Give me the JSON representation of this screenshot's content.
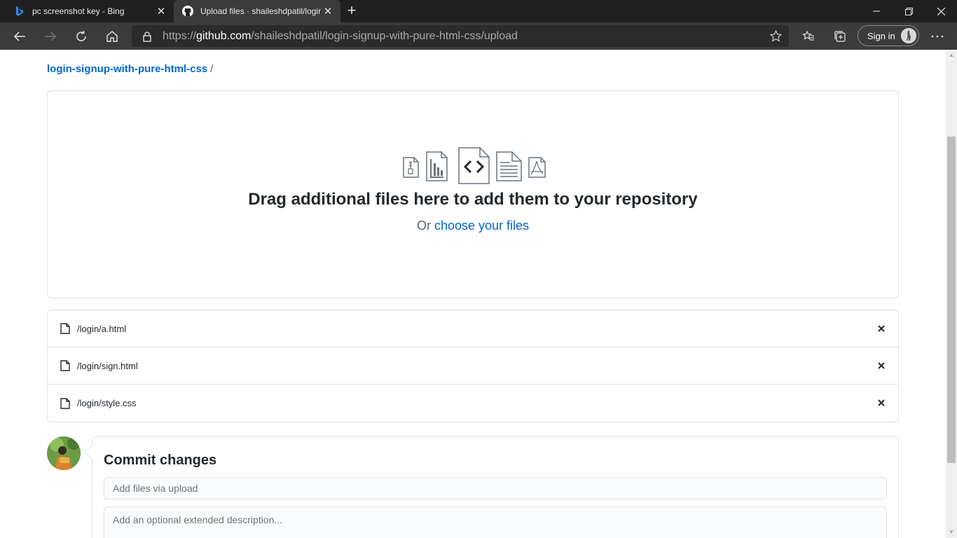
{
  "browser": {
    "tabs": [
      {
        "title": "pc screenshot key - Bing",
        "icon": "bing-icon",
        "active": false
      },
      {
        "title": "Upload files · shaileshdpatil/login-signup-with-pure-html-css",
        "icon": "github-icon",
        "active": true
      }
    ],
    "address": {
      "prefix": "https://",
      "host": "github.com",
      "path": "/shaileshdpatil/login-signup-with-pure-html-css/upload"
    },
    "signin_label": "Sign in"
  },
  "page": {
    "breadcrumb": {
      "repo": "login-signup-with-pure-html-css",
      "separator": "/"
    },
    "dropzone": {
      "title": "Drag additional files here to add them to your repository",
      "prefix": "Or",
      "link": "choose your files"
    },
    "files": [
      {
        "name": "/login/a.html"
      },
      {
        "name": "/login/sign.html"
      },
      {
        "name": "/login/style.css"
      }
    ],
    "commit": {
      "title": "Commit changes",
      "summary_placeholder": "Add files via upload",
      "description_placeholder": "Add an optional extended description..."
    }
  },
  "colors": {
    "link": "#0366d6",
    "text": "#24292e",
    "border": "#e1e4e8",
    "chrome_dark": "#202020",
    "chrome_toolbar": "#3b3b3b"
  }
}
